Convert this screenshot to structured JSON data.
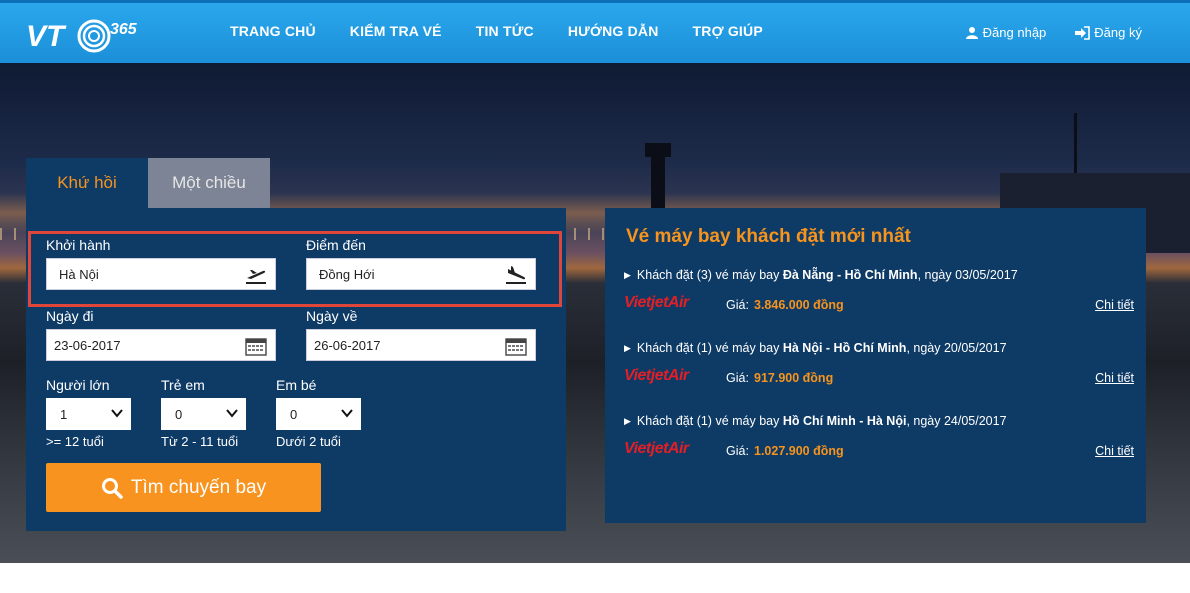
{
  "header": {
    "logo_text": "VTC365",
    "nav": [
      "TRANG CHỦ",
      "KIỂM TRA VÉ",
      "TIN TỨC",
      "HƯỚNG DẪN",
      "TRỢ GIÚP"
    ],
    "login": "Đăng nhập",
    "register": "Đăng ký"
  },
  "booking": {
    "tabs": {
      "round_trip": "Khứ hồi",
      "one_way": "Một chiều"
    },
    "origin_label": "Khởi hành",
    "origin_value": "Hà Nội",
    "destination_label": "Điểm đến",
    "destination_value": "Đồng Hới",
    "depart_label": "Ngày đi",
    "depart_value": "23-06-2017",
    "return_label": "Ngày về",
    "return_value": "26-06-2017",
    "adults_label": "Người lớn",
    "adults_value": "1",
    "adults_hint": ">= 12 tuổi",
    "children_label": "Trẻ em",
    "children_value": "0",
    "children_hint": "Từ 2 - 11 tuổi",
    "infants_label": "Em bé",
    "infants_value": "0",
    "infants_hint": "Dưới 2 tuổi",
    "search_button": "Tìm chuyến bay"
  },
  "recent": {
    "title": "Vé máy bay khách đặt mới nhất",
    "items": [
      {
        "prefix": "Khách đặt (3) vé máy bay",
        "route": "Đà Nẵng - Hồ Chí Minh",
        "date": ", ngày 03/05/2017",
        "airline": "VietjetAir",
        "price_label": "Giá:",
        "price": "3.846.000 đồng",
        "detail": "Chi tiết"
      },
      {
        "prefix": "Khách đặt (1) vé máy bay",
        "route": "Hà Nội - Hồ Chí Minh",
        "date": ", ngày 20/05/2017",
        "airline": "VietjetAir",
        "price_label": "Giá:",
        "price": "917.900 đồng",
        "detail": "Chi tiết"
      },
      {
        "prefix": "Khách đặt (1) vé máy bay",
        "route": "Hồ Chí Minh - Hà Nội",
        "date": ", ngày 24/05/2017",
        "airline": "VietjetAir",
        "price_label": "Giá:",
        "price": "1.027.900 đồng",
        "detail": "Chi tiết"
      }
    ]
  },
  "colors": {
    "header": "#1b8fd8",
    "panel": "#0e3a66",
    "accent": "#f7941d",
    "highlight_border": "#e0453a",
    "airline_red": "#e31f26"
  }
}
